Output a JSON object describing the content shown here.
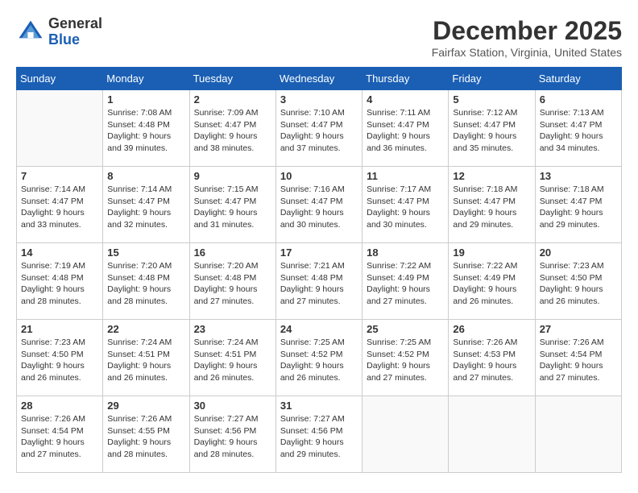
{
  "logo": {
    "general": "General",
    "blue": "Blue"
  },
  "header": {
    "month": "December 2025",
    "location": "Fairfax Station, Virginia, United States"
  },
  "weekdays": [
    "Sunday",
    "Monday",
    "Tuesday",
    "Wednesday",
    "Thursday",
    "Friday",
    "Saturday"
  ],
  "weeks": [
    [
      {
        "day": "",
        "sunrise": "",
        "sunset": "",
        "daylight": ""
      },
      {
        "day": "1",
        "sunrise": "Sunrise: 7:08 AM",
        "sunset": "Sunset: 4:48 PM",
        "daylight": "Daylight: 9 hours and 39 minutes."
      },
      {
        "day": "2",
        "sunrise": "Sunrise: 7:09 AM",
        "sunset": "Sunset: 4:47 PM",
        "daylight": "Daylight: 9 hours and 38 minutes."
      },
      {
        "day": "3",
        "sunrise": "Sunrise: 7:10 AM",
        "sunset": "Sunset: 4:47 PM",
        "daylight": "Daylight: 9 hours and 37 minutes."
      },
      {
        "day": "4",
        "sunrise": "Sunrise: 7:11 AM",
        "sunset": "Sunset: 4:47 PM",
        "daylight": "Daylight: 9 hours and 36 minutes."
      },
      {
        "day": "5",
        "sunrise": "Sunrise: 7:12 AM",
        "sunset": "Sunset: 4:47 PM",
        "daylight": "Daylight: 9 hours and 35 minutes."
      },
      {
        "day": "6",
        "sunrise": "Sunrise: 7:13 AM",
        "sunset": "Sunset: 4:47 PM",
        "daylight": "Daylight: 9 hours and 34 minutes."
      }
    ],
    [
      {
        "day": "7",
        "sunrise": "Sunrise: 7:14 AM",
        "sunset": "Sunset: 4:47 PM",
        "daylight": "Daylight: 9 hours and 33 minutes."
      },
      {
        "day": "8",
        "sunrise": "Sunrise: 7:14 AM",
        "sunset": "Sunset: 4:47 PM",
        "daylight": "Daylight: 9 hours and 32 minutes."
      },
      {
        "day": "9",
        "sunrise": "Sunrise: 7:15 AM",
        "sunset": "Sunset: 4:47 PM",
        "daylight": "Daylight: 9 hours and 31 minutes."
      },
      {
        "day": "10",
        "sunrise": "Sunrise: 7:16 AM",
        "sunset": "Sunset: 4:47 PM",
        "daylight": "Daylight: 9 hours and 30 minutes."
      },
      {
        "day": "11",
        "sunrise": "Sunrise: 7:17 AM",
        "sunset": "Sunset: 4:47 PM",
        "daylight": "Daylight: 9 hours and 30 minutes."
      },
      {
        "day": "12",
        "sunrise": "Sunrise: 7:18 AM",
        "sunset": "Sunset: 4:47 PM",
        "daylight": "Daylight: 9 hours and 29 minutes."
      },
      {
        "day": "13",
        "sunrise": "Sunrise: 7:18 AM",
        "sunset": "Sunset: 4:47 PM",
        "daylight": "Daylight: 9 hours and 29 minutes."
      }
    ],
    [
      {
        "day": "14",
        "sunrise": "Sunrise: 7:19 AM",
        "sunset": "Sunset: 4:48 PM",
        "daylight": "Daylight: 9 hours and 28 minutes."
      },
      {
        "day": "15",
        "sunrise": "Sunrise: 7:20 AM",
        "sunset": "Sunset: 4:48 PM",
        "daylight": "Daylight: 9 hours and 28 minutes."
      },
      {
        "day": "16",
        "sunrise": "Sunrise: 7:20 AM",
        "sunset": "Sunset: 4:48 PM",
        "daylight": "Daylight: 9 hours and 27 minutes."
      },
      {
        "day": "17",
        "sunrise": "Sunrise: 7:21 AM",
        "sunset": "Sunset: 4:48 PM",
        "daylight": "Daylight: 9 hours and 27 minutes."
      },
      {
        "day": "18",
        "sunrise": "Sunrise: 7:22 AM",
        "sunset": "Sunset: 4:49 PM",
        "daylight": "Daylight: 9 hours and 27 minutes."
      },
      {
        "day": "19",
        "sunrise": "Sunrise: 7:22 AM",
        "sunset": "Sunset: 4:49 PM",
        "daylight": "Daylight: 9 hours and 26 minutes."
      },
      {
        "day": "20",
        "sunrise": "Sunrise: 7:23 AM",
        "sunset": "Sunset: 4:50 PM",
        "daylight": "Daylight: 9 hours and 26 minutes."
      }
    ],
    [
      {
        "day": "21",
        "sunrise": "Sunrise: 7:23 AM",
        "sunset": "Sunset: 4:50 PM",
        "daylight": "Daylight: 9 hours and 26 minutes."
      },
      {
        "day": "22",
        "sunrise": "Sunrise: 7:24 AM",
        "sunset": "Sunset: 4:51 PM",
        "daylight": "Daylight: 9 hours and 26 minutes."
      },
      {
        "day": "23",
        "sunrise": "Sunrise: 7:24 AM",
        "sunset": "Sunset: 4:51 PM",
        "daylight": "Daylight: 9 hours and 26 minutes."
      },
      {
        "day": "24",
        "sunrise": "Sunrise: 7:25 AM",
        "sunset": "Sunset: 4:52 PM",
        "daylight": "Daylight: 9 hours and 26 minutes."
      },
      {
        "day": "25",
        "sunrise": "Sunrise: 7:25 AM",
        "sunset": "Sunset: 4:52 PM",
        "daylight": "Daylight: 9 hours and 27 minutes."
      },
      {
        "day": "26",
        "sunrise": "Sunrise: 7:26 AM",
        "sunset": "Sunset: 4:53 PM",
        "daylight": "Daylight: 9 hours and 27 minutes."
      },
      {
        "day": "27",
        "sunrise": "Sunrise: 7:26 AM",
        "sunset": "Sunset: 4:54 PM",
        "daylight": "Daylight: 9 hours and 27 minutes."
      }
    ],
    [
      {
        "day": "28",
        "sunrise": "Sunrise: 7:26 AM",
        "sunset": "Sunset: 4:54 PM",
        "daylight": "Daylight: 9 hours and 27 minutes."
      },
      {
        "day": "29",
        "sunrise": "Sunrise: 7:26 AM",
        "sunset": "Sunset: 4:55 PM",
        "daylight": "Daylight: 9 hours and 28 minutes."
      },
      {
        "day": "30",
        "sunrise": "Sunrise: 7:27 AM",
        "sunset": "Sunset: 4:56 PM",
        "daylight": "Daylight: 9 hours and 28 minutes."
      },
      {
        "day": "31",
        "sunrise": "Sunrise: 7:27 AM",
        "sunset": "Sunset: 4:56 PM",
        "daylight": "Daylight: 9 hours and 29 minutes."
      },
      {
        "day": "",
        "sunrise": "",
        "sunset": "",
        "daylight": ""
      },
      {
        "day": "",
        "sunrise": "",
        "sunset": "",
        "daylight": ""
      },
      {
        "day": "",
        "sunrise": "",
        "sunset": "",
        "daylight": ""
      }
    ]
  ]
}
